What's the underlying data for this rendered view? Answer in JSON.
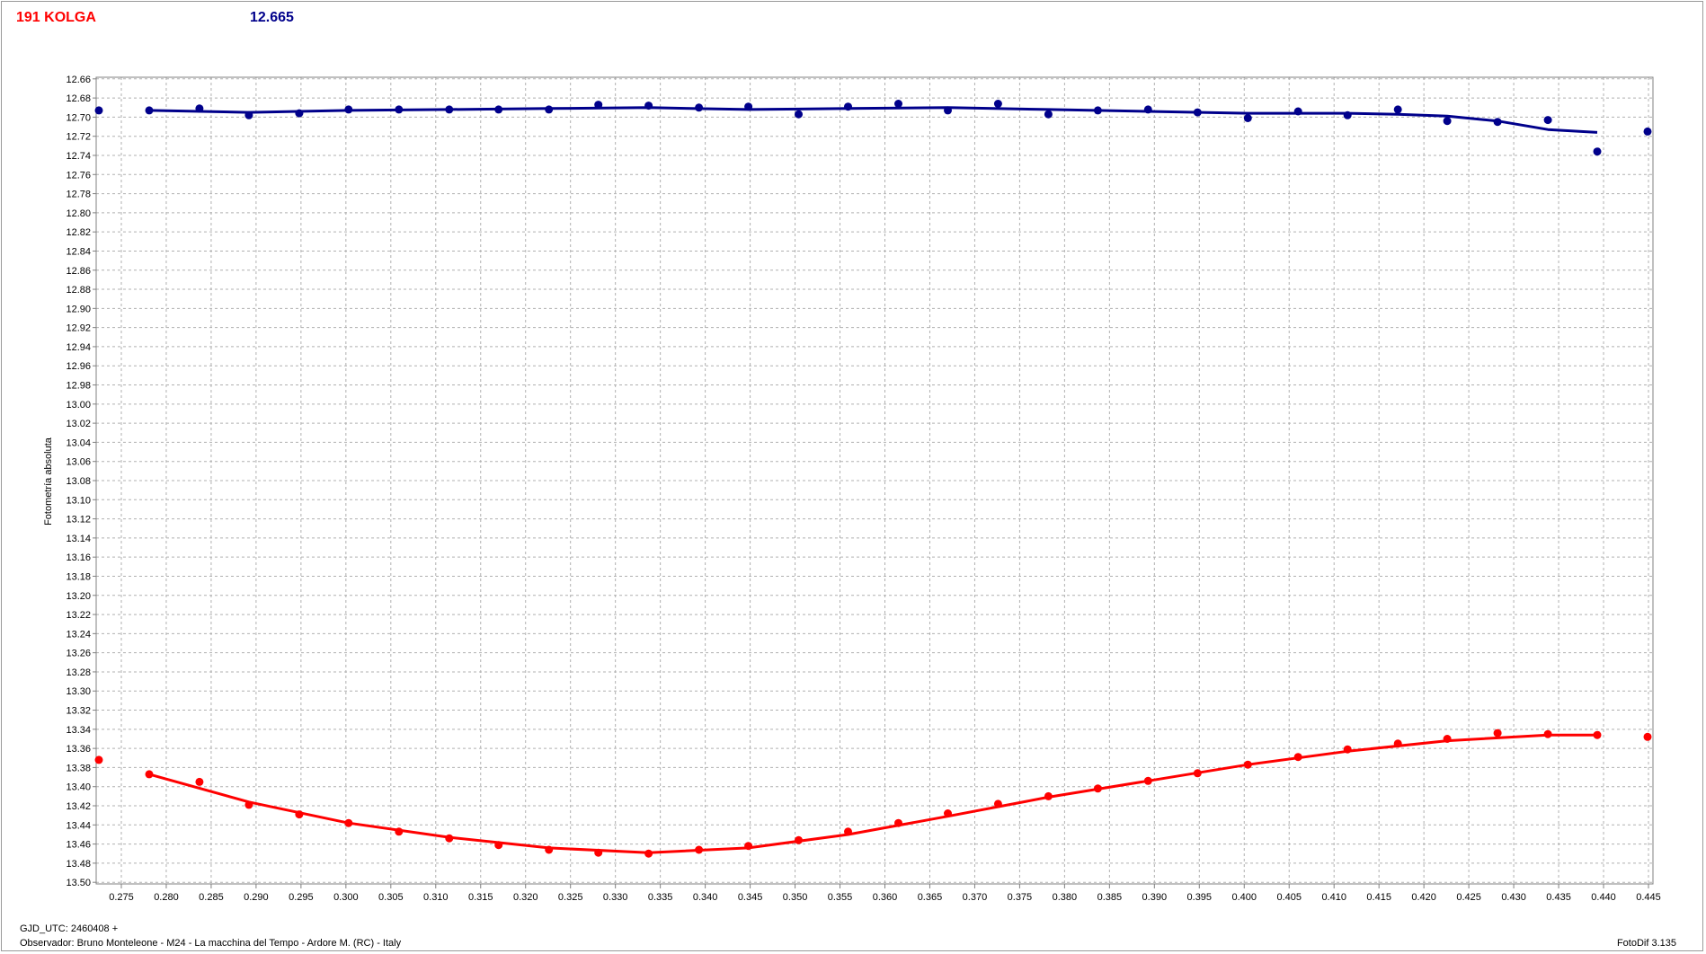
{
  "header": {
    "title": "191 KOLGA",
    "value": "12.665"
  },
  "footer": {
    "gjd": "GJD_UTC: 2460408 +",
    "observer": "Observador: Bruno Monteleone - M24 - La macchina del Tempo - Ardore M. (RC) - Italy",
    "version": "FotoDif 3.135"
  },
  "chart_data": {
    "type": "scatter",
    "title": "",
    "xlabel": "",
    "ylabel": "Fotometría absoluta",
    "xlim": [
      0.2722,
      0.4455
    ],
    "ylim": [
      12.6583,
      13.5017
    ],
    "y_inverted": true,
    "grid": true,
    "x_ticks": [
      "0.275",
      "0.280",
      "0.285",
      "0.290",
      "0.295",
      "0.300",
      "0.305",
      "0.310",
      "0.315",
      "0.320",
      "0.325",
      "0.330",
      "0.335",
      "0.340",
      "0.345",
      "0.350",
      "0.355",
      "0.360",
      "0.365",
      "0.370",
      "0.375",
      "0.380",
      "0.385",
      "0.390",
      "0.395",
      "0.400",
      "0.405",
      "0.410",
      "0.415",
      "0.420",
      "0.425",
      "0.430",
      "0.435",
      "0.440",
      "0.445"
    ],
    "y_ticks": [
      "12.66",
      "12.68",
      "12.70",
      "12.72",
      "12.74",
      "12.76",
      "12.78",
      "12.80",
      "12.82",
      "12.84",
      "12.86",
      "12.88",
      "12.90",
      "12.92",
      "12.94",
      "12.96",
      "12.98",
      "13.00",
      "13.02",
      "13.04",
      "13.06",
      "13.08",
      "13.10",
      "13.12",
      "13.14",
      "13.16",
      "13.18",
      "13.20",
      "13.22",
      "13.24",
      "13.26",
      "13.28",
      "13.30",
      "13.32",
      "13.34",
      "13.36",
      "13.38",
      "13.40",
      "13.42",
      "13.44",
      "13.46",
      "13.48",
      "13.50"
    ],
    "series": [
      {
        "color": "#00008b",
        "points": {
          "x": [
            0.2725,
            0.2781,
            0.2837,
            0.2892,
            0.2948,
            0.3003,
            0.3059,
            0.3115,
            0.317,
            0.3226,
            0.3281,
            0.3337,
            0.3393,
            0.3448,
            0.3504,
            0.3559,
            0.3615,
            0.367,
            0.3726,
            0.3782,
            0.3837,
            0.3893,
            0.3948,
            0.4004,
            0.406,
            0.4115,
            0.4171,
            0.4226,
            0.4282,
            0.4338,
            0.4393,
            0.4449
          ],
          "y": [
            12.693,
            12.693,
            12.691,
            12.698,
            12.696,
            12.692,
            12.692,
            12.692,
            12.692,
            12.692,
            12.687,
            12.688,
            12.69,
            12.689,
            12.697,
            12.689,
            12.686,
            12.693,
            12.686,
            12.697,
            12.693,
            12.692,
            12.695,
            12.701,
            12.694,
            12.698,
            12.692,
            12.704,
            12.705,
            12.703,
            12.736,
            12.715
          ]
        },
        "fit": {
          "x": [
            0.2781,
            0.2892,
            0.3003,
            0.3115,
            0.3226,
            0.3337,
            0.3448,
            0.3559,
            0.367,
            0.3782,
            0.3893,
            0.4004,
            0.4115,
            0.4171,
            0.4226,
            0.4282,
            0.4338,
            0.4393
          ],
          "y": [
            12.693,
            12.695,
            12.693,
            12.692,
            12.691,
            12.69,
            12.692,
            12.691,
            12.69,
            12.692,
            12.694,
            12.696,
            12.696,
            12.697,
            12.699,
            12.704,
            12.713,
            12.716
          ]
        }
      },
      {
        "color": "#ff0000",
        "points": {
          "x": [
            0.2725,
            0.2781,
            0.2837,
            0.2892,
            0.2948,
            0.3003,
            0.3059,
            0.3115,
            0.317,
            0.3226,
            0.3281,
            0.3337,
            0.3393,
            0.3448,
            0.3504,
            0.3559,
            0.3615,
            0.367,
            0.3726,
            0.3782,
            0.3837,
            0.3893,
            0.3948,
            0.4004,
            0.406,
            0.4115,
            0.4171,
            0.4226,
            0.4282,
            0.4338,
            0.4393,
            0.4449
          ],
          "y": [
            13.372,
            13.387,
            13.395,
            13.419,
            13.429,
            13.438,
            13.447,
            13.454,
            13.461,
            13.466,
            13.469,
            13.47,
            13.466,
            13.462,
            13.456,
            13.447,
            13.438,
            13.428,
            13.418,
            13.41,
            13.402,
            13.394,
            13.386,
            13.377,
            13.369,
            13.361,
            13.355,
            13.35,
            13.344,
            13.345,
            13.346,
            13.348
          ]
        },
        "fit": {
          "x": [
            0.2781,
            0.2892,
            0.3003,
            0.3115,
            0.3226,
            0.3337,
            0.3448,
            0.3559,
            0.367,
            0.3782,
            0.3893,
            0.4004,
            0.4115,
            0.4226,
            0.4338,
            0.4393
          ],
          "y": [
            13.387,
            13.416,
            13.438,
            13.453,
            13.464,
            13.469,
            13.464,
            13.45,
            13.431,
            13.411,
            13.394,
            13.377,
            13.363,
            13.352,
            13.346,
            13.346
          ]
        }
      }
    ]
  }
}
